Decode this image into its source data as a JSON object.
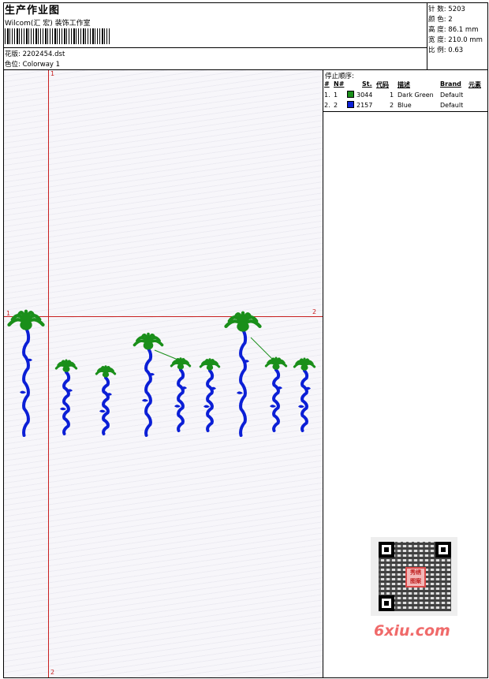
{
  "header": {
    "title": "生产作业图",
    "company": "Wilcom(汇 宏) 装饰工作室",
    "design_label": "花版:",
    "design_value": "2202454.dst",
    "colorway_label": "色位:",
    "colorway_value": "Colorway 1"
  },
  "stats": {
    "stitches_label": "针 数:",
    "stitches_value": "5203",
    "colors_label": "颜 色:",
    "colors_value": "2",
    "height_label": "高 度:",
    "height_value": "86.1 mm",
    "width_label": "宽 度:",
    "width_value": "210.0 mm",
    "scale_label": "比 例:",
    "scale_value": "0.63"
  },
  "guides": {
    "v_top": "1",
    "v_bottom": "2",
    "h_left": "1",
    "h_right": "2"
  },
  "colors": {
    "guide": "#c82020",
    "thread_1": "#1a8f1a",
    "thread_2": "#0b1fd6"
  },
  "stop_sequence": {
    "title": "停止顺序:",
    "headers": [
      "#",
      "N#",
      "St.",
      "代码",
      "描述",
      "Brand",
      "元素"
    ],
    "rows": [
      {
        "idx": "1.",
        "n": "1",
        "st": "3044",
        "code": "1",
        "desc": "Dark Green",
        "brand": "Default",
        "color": "#1a8f1a"
      },
      {
        "idx": "2.",
        "n": "2",
        "st": "2157",
        "code": "2",
        "desc": "Blue",
        "brand": "Default",
        "color": "#0b1fd6"
      }
    ]
  },
  "watermark": {
    "text": "6xiu.com",
    "qr_badge": "秀绣\n图案"
  }
}
